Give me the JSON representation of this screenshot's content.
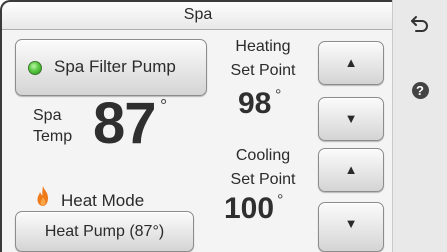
{
  "header": {
    "title": "Spa"
  },
  "sidebar": {
    "back_icon": "back-arrow-icon",
    "help_icon": "help-icon",
    "help_glyph": "?"
  },
  "pump": {
    "label": "Spa Filter Pump",
    "led_state": "on",
    "led_color": "#4cc23a"
  },
  "spa_temp": {
    "label_line1": "Spa",
    "label_line2": "Temp",
    "value": "87",
    "unit": "°"
  },
  "heating": {
    "label_line1": "Heating",
    "label_line2": "Set Point",
    "value": "98",
    "unit": "°",
    "up_glyph": "▲",
    "down_glyph": "▼"
  },
  "cooling": {
    "label_line1": "Cooling",
    "label_line2": "Set Point",
    "value": "100",
    "unit": "°",
    "up_glyph": "▲",
    "down_glyph": "▼"
  },
  "heat_mode": {
    "label": "Heat Mode",
    "icon": "flame-icon",
    "icon_color": "#ef7a1a",
    "button_label": "Heat Pump (87°)"
  }
}
